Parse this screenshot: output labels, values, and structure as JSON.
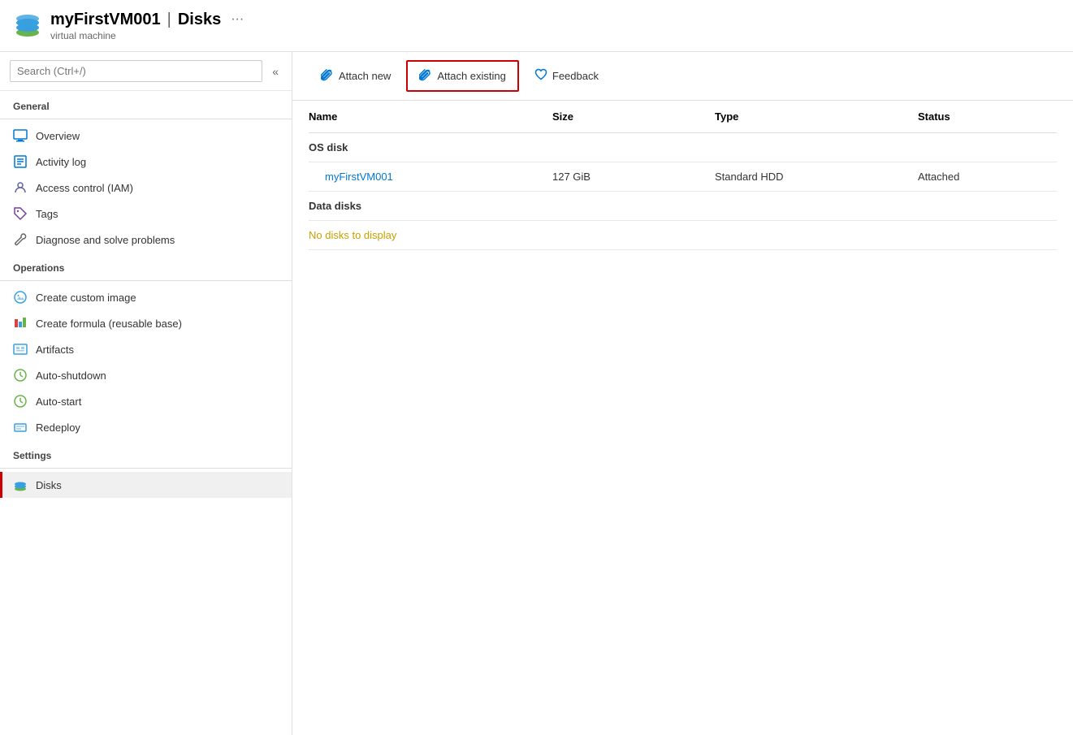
{
  "header": {
    "title": "myFirstVM001",
    "separator": "|",
    "section": "Disks",
    "subtitle": "virtual machine",
    "ellipsis": "···"
  },
  "sidebar": {
    "search_placeholder": "Search (Ctrl+/)",
    "collapse_icon": "«",
    "sections": [
      {
        "title": "General",
        "items": [
          {
            "label": "Overview",
            "icon": "monitor-icon"
          },
          {
            "label": "Activity log",
            "icon": "activitylog-icon"
          },
          {
            "label": "Access control (IAM)",
            "icon": "iam-icon"
          },
          {
            "label": "Tags",
            "icon": "tag-icon"
          },
          {
            "label": "Diagnose and solve problems",
            "icon": "wrench-icon"
          }
        ]
      },
      {
        "title": "Operations",
        "items": [
          {
            "label": "Create custom image",
            "icon": "image-icon"
          },
          {
            "label": "Create formula (reusable base)",
            "icon": "formula-icon"
          },
          {
            "label": "Artifacts",
            "icon": "artifacts-icon"
          },
          {
            "label": "Auto-shutdown",
            "icon": "clock-icon"
          },
          {
            "label": "Auto-start",
            "icon": "clock-icon"
          },
          {
            "label": "Redeploy",
            "icon": "redeploy-icon"
          }
        ]
      },
      {
        "title": "Settings",
        "items": [
          {
            "label": "Disks",
            "icon": "disk-icon",
            "active": true
          }
        ]
      }
    ]
  },
  "toolbar": {
    "buttons": [
      {
        "label": "Attach new",
        "icon": "paperclip-icon",
        "active": false
      },
      {
        "label": "Attach existing",
        "icon": "paperclip-icon",
        "active": true
      },
      {
        "label": "Feedback",
        "icon": "heart-icon",
        "active": false
      }
    ]
  },
  "table": {
    "columns": [
      "Name",
      "Size",
      "Type",
      "Status"
    ],
    "sections": [
      {
        "title": "OS disk",
        "rows": [
          {
            "name": "myFirstVM001",
            "size": "127 GiB",
            "type": "Standard HDD",
            "status": "Attached"
          }
        ]
      },
      {
        "title": "Data disks",
        "rows": [],
        "empty_message": "No disks to display"
      }
    ]
  }
}
